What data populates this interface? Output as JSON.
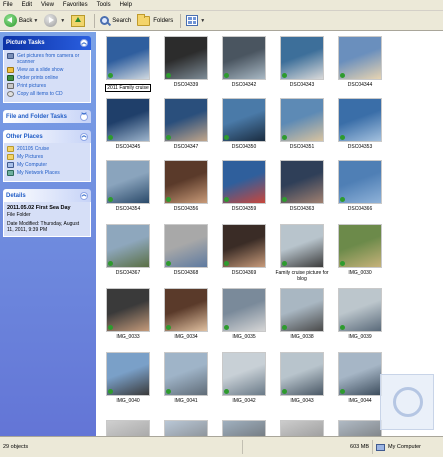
{
  "menu": [
    "File",
    "Edit",
    "View",
    "Favorites",
    "Tools",
    "Help"
  ],
  "toolbar": {
    "back": "Back",
    "search": "Search",
    "folders": "Folders"
  },
  "taskpane": {
    "picture_tasks": {
      "title": "Picture Tasks",
      "items": [
        "Get pictures from camera or scanner",
        "View as a slide show",
        "Order prints online",
        "Print pictures",
        "Copy all items to CD"
      ]
    },
    "file_folder_tasks": {
      "title": "File and Folder Tasks"
    },
    "other_places": {
      "title": "Other Places",
      "items": [
        "201105 Cruise",
        "My Pictures",
        "My Computer",
        "My Network Places"
      ]
    },
    "details": {
      "title": "Details",
      "name": "2011.05.02 First Sea Day",
      "type": "File Folder",
      "modified": "Date Modified: Thursday, August 11, 2011, 9:39 PM"
    }
  },
  "thumbnails": [
    {
      "label": "2011 Family cruise",
      "colors": [
        "#2f5e9e",
        "#cfd8e0"
      ]
    },
    {
      "label": "DSC04339",
      "colors": [
        "#2c2c2c",
        "#7d8b96"
      ]
    },
    {
      "label": "DSC04342",
      "colors": [
        "#4a5560",
        "#a8b8c4"
      ]
    },
    {
      "label": "DSC04343",
      "colors": [
        "#3d6f9a",
        "#d9d9d9"
      ]
    },
    {
      "label": "DSC04344",
      "colors": [
        "#6a8fbd",
        "#e7d4b2"
      ]
    },
    {
      "label": "DSC04345",
      "colors": [
        "#1f3f6a",
        "#9db4cc"
      ]
    },
    {
      "label": "DSC04347",
      "colors": [
        "#2a4f7c",
        "#c0a58a"
      ]
    },
    {
      "label": "DSC04350",
      "colors": [
        "#4a7aa8",
        "#1a2c40"
      ]
    },
    {
      "label": "DSC04351",
      "colors": [
        "#5d8ab5",
        "#d8c3a0"
      ]
    },
    {
      "label": "DSC04353",
      "colors": [
        "#3a6ea8",
        "#a4c1de"
      ]
    },
    {
      "label": "DSC04354",
      "colors": [
        "#8aa4bd",
        "#2b4a6a"
      ]
    },
    {
      "label": "DSC04356",
      "colors": [
        "#5a3a2a",
        "#c89a78"
      ]
    },
    {
      "label": "DSC04359",
      "colors": [
        "#2f5f9c",
        "#c8463c"
      ]
    },
    {
      "label": "DSC04363",
      "colors": [
        "#2f3f58",
        "#a08070"
      ]
    },
    {
      "label": "DSC04366",
      "colors": [
        "#4f7fb5",
        "#8fb2d8"
      ]
    },
    {
      "label": "DSC04367",
      "colors": [
        "#8ea7bd",
        "#5a6f44"
      ]
    },
    {
      "label": "DSC04368",
      "colors": [
        "#a8a8a8",
        "#5e7aa0"
      ]
    },
    {
      "label": "DSC04369",
      "colors": [
        "#3a2c26",
        "#c79a7a"
      ]
    },
    {
      "label": "Family cruise picture for blog",
      "colors": [
        "#b8c4cc",
        "#3c3c3c"
      ]
    },
    {
      "label": "IMG_0030",
      "colors": [
        "#6c8a4a",
        "#c6b27a"
      ]
    },
    {
      "label": "IMG_0033",
      "colors": [
        "#3a3a3a",
        "#c49a7a"
      ]
    },
    {
      "label": "IMG_0034",
      "colors": [
        "#5a3a2a",
        "#e0c0a0"
      ]
    },
    {
      "label": "IMG_0035",
      "colors": [
        "#7a8a9a",
        "#d6d6d6"
      ]
    },
    {
      "label": "IMG_0038",
      "colors": [
        "#a9b7c2",
        "#4a4a4a"
      ]
    },
    {
      "label": "IMG_0039",
      "colors": [
        "#bcc6cc",
        "#5a6a7a"
      ]
    },
    {
      "label": "IMG_0040",
      "colors": [
        "#7aa0c8",
        "#3a3a3a"
      ]
    },
    {
      "label": "IMG_0041",
      "colors": [
        "#9fb4c8",
        "#606c78"
      ]
    },
    {
      "label": "IMG_0042",
      "colors": [
        "#c8d0d6",
        "#6a7a88"
      ]
    },
    {
      "label": "IMG_0043",
      "colors": [
        "#b8c4cc",
        "#4a5866"
      ]
    },
    {
      "label": "IMG_0044",
      "colors": [
        "#a6b6c6",
        "#3c4c5c"
      ]
    }
  ],
  "partial_row_colors": [
    [
      "#cfcfcf",
      "#8a8a8a"
    ],
    [
      "#b9c7d6",
      "#6a6a6a"
    ],
    [
      "#a0b0bf",
      "#525252"
    ],
    [
      "#cccccc",
      "#7a7a7a"
    ],
    [
      "#b0bac4",
      "#5a5a5a"
    ]
  ],
  "status": {
    "objects": "29 objects",
    "size": "603 MB",
    "location": "My Computer"
  }
}
